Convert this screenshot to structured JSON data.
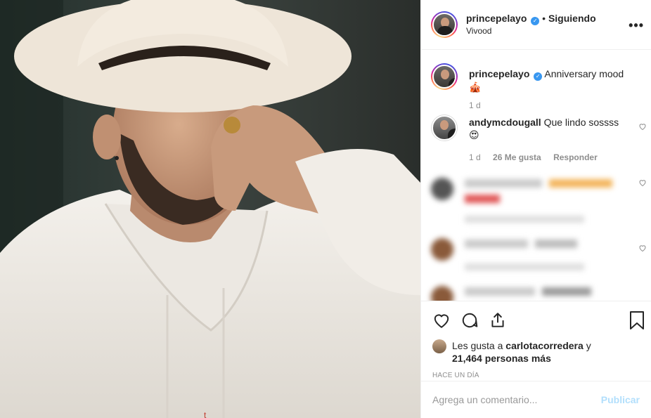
{
  "header": {
    "username": "princepelayo",
    "follow_status": "Siguiendo",
    "location": "Vivood",
    "more_icon": "more-dots-icon"
  },
  "caption": {
    "username": "princepelayo",
    "text": "Anniversary mood",
    "emoji": "🎪",
    "time": "1 d"
  },
  "comments": [
    {
      "username": "andymcdougall",
      "text": "Que lindo sossss",
      "emoji": "😍",
      "time": "1 d",
      "likes": "26 Me gusta",
      "reply": "Responder"
    }
  ],
  "actions": {
    "like_icon": "heart-icon",
    "comment_icon": "comment-icon",
    "share_icon": "share-icon",
    "save_icon": "bookmark-icon"
  },
  "likes": {
    "prefix": "Les gusta a",
    "user": "carlotacorredera",
    "connector": "y",
    "count_text": "21,464 personas más"
  },
  "posted": "HACE UN DÍA",
  "add_comment": {
    "placeholder": "Agrega un comentario...",
    "publish": "Publicar"
  },
  "colors": {
    "verified": "#3897f0",
    "publish_disabled": "#b2dffc",
    "meta": "#8e8e8e"
  }
}
